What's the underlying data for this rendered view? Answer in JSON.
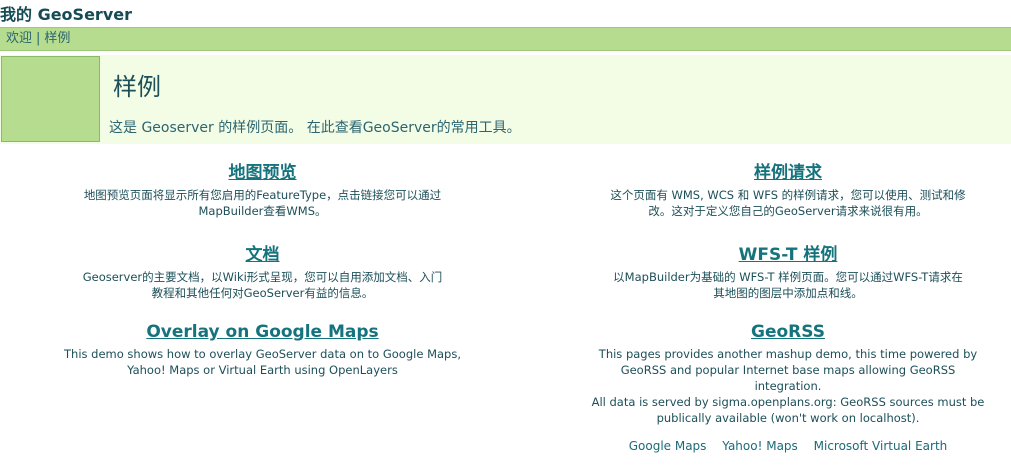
{
  "site_title": "我的 GeoServer",
  "nav": {
    "welcome": "欢迎",
    "separator": "|",
    "samples": "样例"
  },
  "hero": {
    "title": "样例",
    "description": "这是 Geoserver 的样例页面。 在此查看GeoServer的常用工具。"
  },
  "cards": [
    {
      "title": "地图预览",
      "desc": [
        "地图预览页面将显示所有您启用的FeatureType，点击链接您可以通过",
        "MapBuilder查看WMS。"
      ]
    },
    {
      "title": "样例请求",
      "desc": [
        "这个页面有 WMS, WCS 和 WFS 的样例请求，您可以使用、测试和修",
        "改。这对于定义您自己的GeoServer请求来说很有用。"
      ]
    },
    {
      "title": "文档",
      "desc": [
        "Geoserver的主要文档，以Wiki形式呈现，您可以自用添加文档、入门",
        "教程和其他任何对GeoServer有益的信息。"
      ]
    },
    {
      "title": "WFS-T 样例",
      "desc": [
        "以MapBuilder为基础的 WFS-T 样例页面。您可以通过WFS-T请求在",
        "其地图的图层中添加点和线。"
      ]
    },
    {
      "title": "Overlay on Google Maps",
      "desc": [
        "This demo shows how to overlay GeoServer data on to Google Maps,",
        "Yahoo! Maps or Virtual Earth using OpenLayers"
      ]
    },
    {
      "title": "GeoRSS",
      "desc": [
        "This pages provides another mashup demo, this time powered by",
        "GeoRSS and popular Internet base maps allowing GeoRSS",
        "integration.",
        "All data is served by sigma.openplans.org: GeoRSS sources must be",
        "publically available (won't work on localhost)."
      ],
      "links": [
        "Google Maps",
        "Yahoo! Maps",
        "Microsoft Virtual Earth"
      ]
    }
  ]
}
